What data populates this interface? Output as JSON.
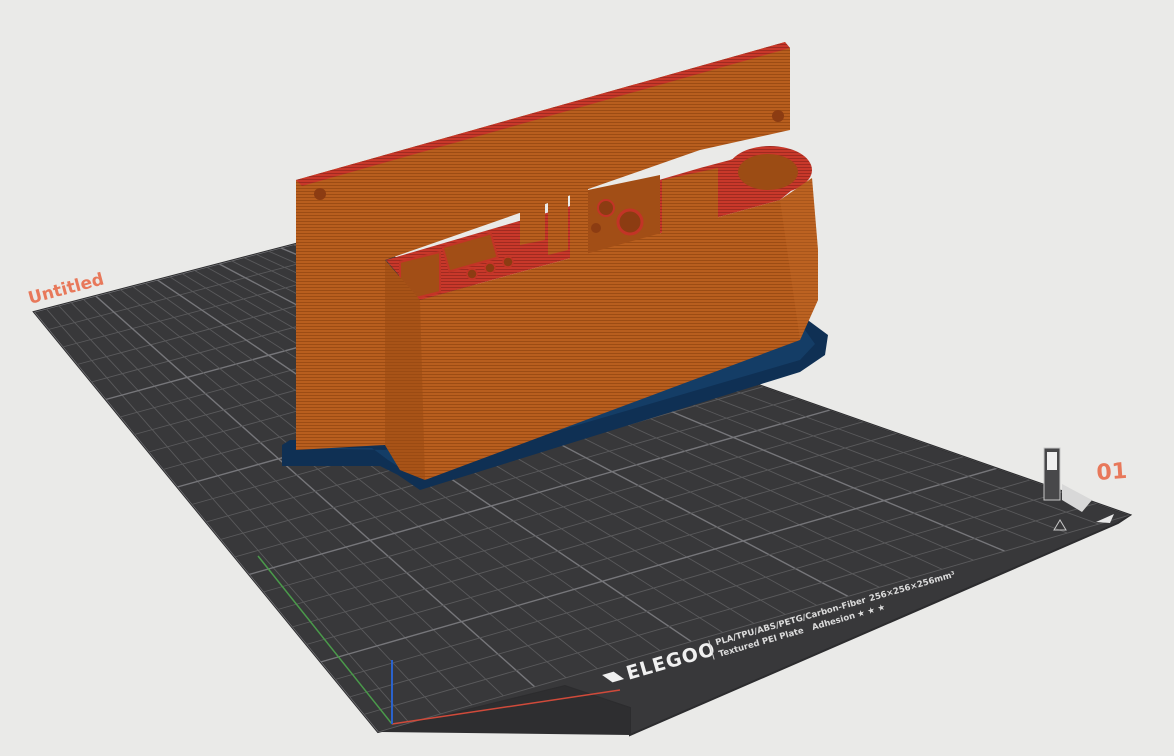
{
  "project": {
    "name": "Untitled"
  },
  "plate": {
    "index_label": "01",
    "brand": "ELEGOO",
    "spec_line1": "PLA/TPU/ABS/PETG/Carbon-Fiber",
    "spec_size": "256×256×256mm³",
    "spec_line2_a": "Textured PEI Plate",
    "spec_line2_b": "Adhesion",
    "adhesion_stars": "★ ★ ★",
    "adhesion_rating": 3,
    "adhesion_rating_max": 3
  },
  "colors": {
    "background": "#eaeae8",
    "plate": "#38383a",
    "grid": "#626264",
    "accent": "#e8785a",
    "model": "#b45a1c",
    "model_top": "#c23426",
    "brim": "#0f3054",
    "axis_x": "#d04a3a",
    "axis_y": "#4a9a4a",
    "axis_z": "#2a62cc"
  },
  "icons": {
    "brand_logo": "elegoo-logo-icon",
    "plate_warning": "hot-surface-warning-icon",
    "plate_toggle": "plate-toggle-icon"
  }
}
